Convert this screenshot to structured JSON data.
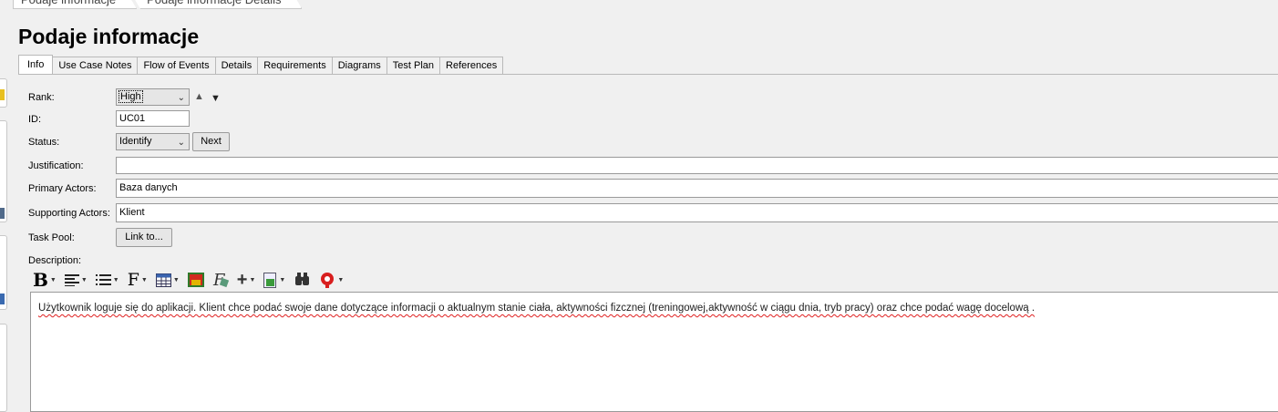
{
  "breadcrumb": [
    "Podaje informacje",
    "Podaje informacje Details"
  ],
  "page_title": "Podaje informacje",
  "tabs": [
    {
      "label": "Info",
      "active": true
    },
    {
      "label": "Use Case Notes"
    },
    {
      "label": "Flow of Events"
    },
    {
      "label": "Details"
    },
    {
      "label": "Requirements"
    },
    {
      "label": "Diagrams"
    },
    {
      "label": "Test Plan"
    },
    {
      "label": "References"
    }
  ],
  "form": {
    "rank_label": "Rank:",
    "rank_value": "High",
    "id_label": "ID:",
    "id_value": "UC01",
    "status_label": "Status:",
    "status_value": "Identify",
    "next_button": "Next",
    "justification_label": "Justification:",
    "justification_value": "",
    "primary_actors_label": "Primary Actors:",
    "primary_actors_value": "Baza danych",
    "supporting_actors_label": "Supporting Actors:",
    "supporting_actors_value": "Klient",
    "task_pool_label": "Task Pool:",
    "link_button": "Link to...",
    "description_label": "Description:"
  },
  "toolbar_icons": [
    "bold-icon",
    "align-icon",
    "list-icon",
    "font-icon",
    "table-icon",
    "image-icon",
    "formula-icon",
    "insert-icon",
    "document-icon",
    "find-icon",
    "spellcheck-icon"
  ],
  "description_text": "Użytkownik loguje się do aplikacji. Klient chce podać swoje dane dotyczące informacji o aktualnym stanie ciała, aktywności fizcznej (treningowej,aktywność w ciągu dnia, tryb pracy) oraz chce podać wagę docelową ."
}
